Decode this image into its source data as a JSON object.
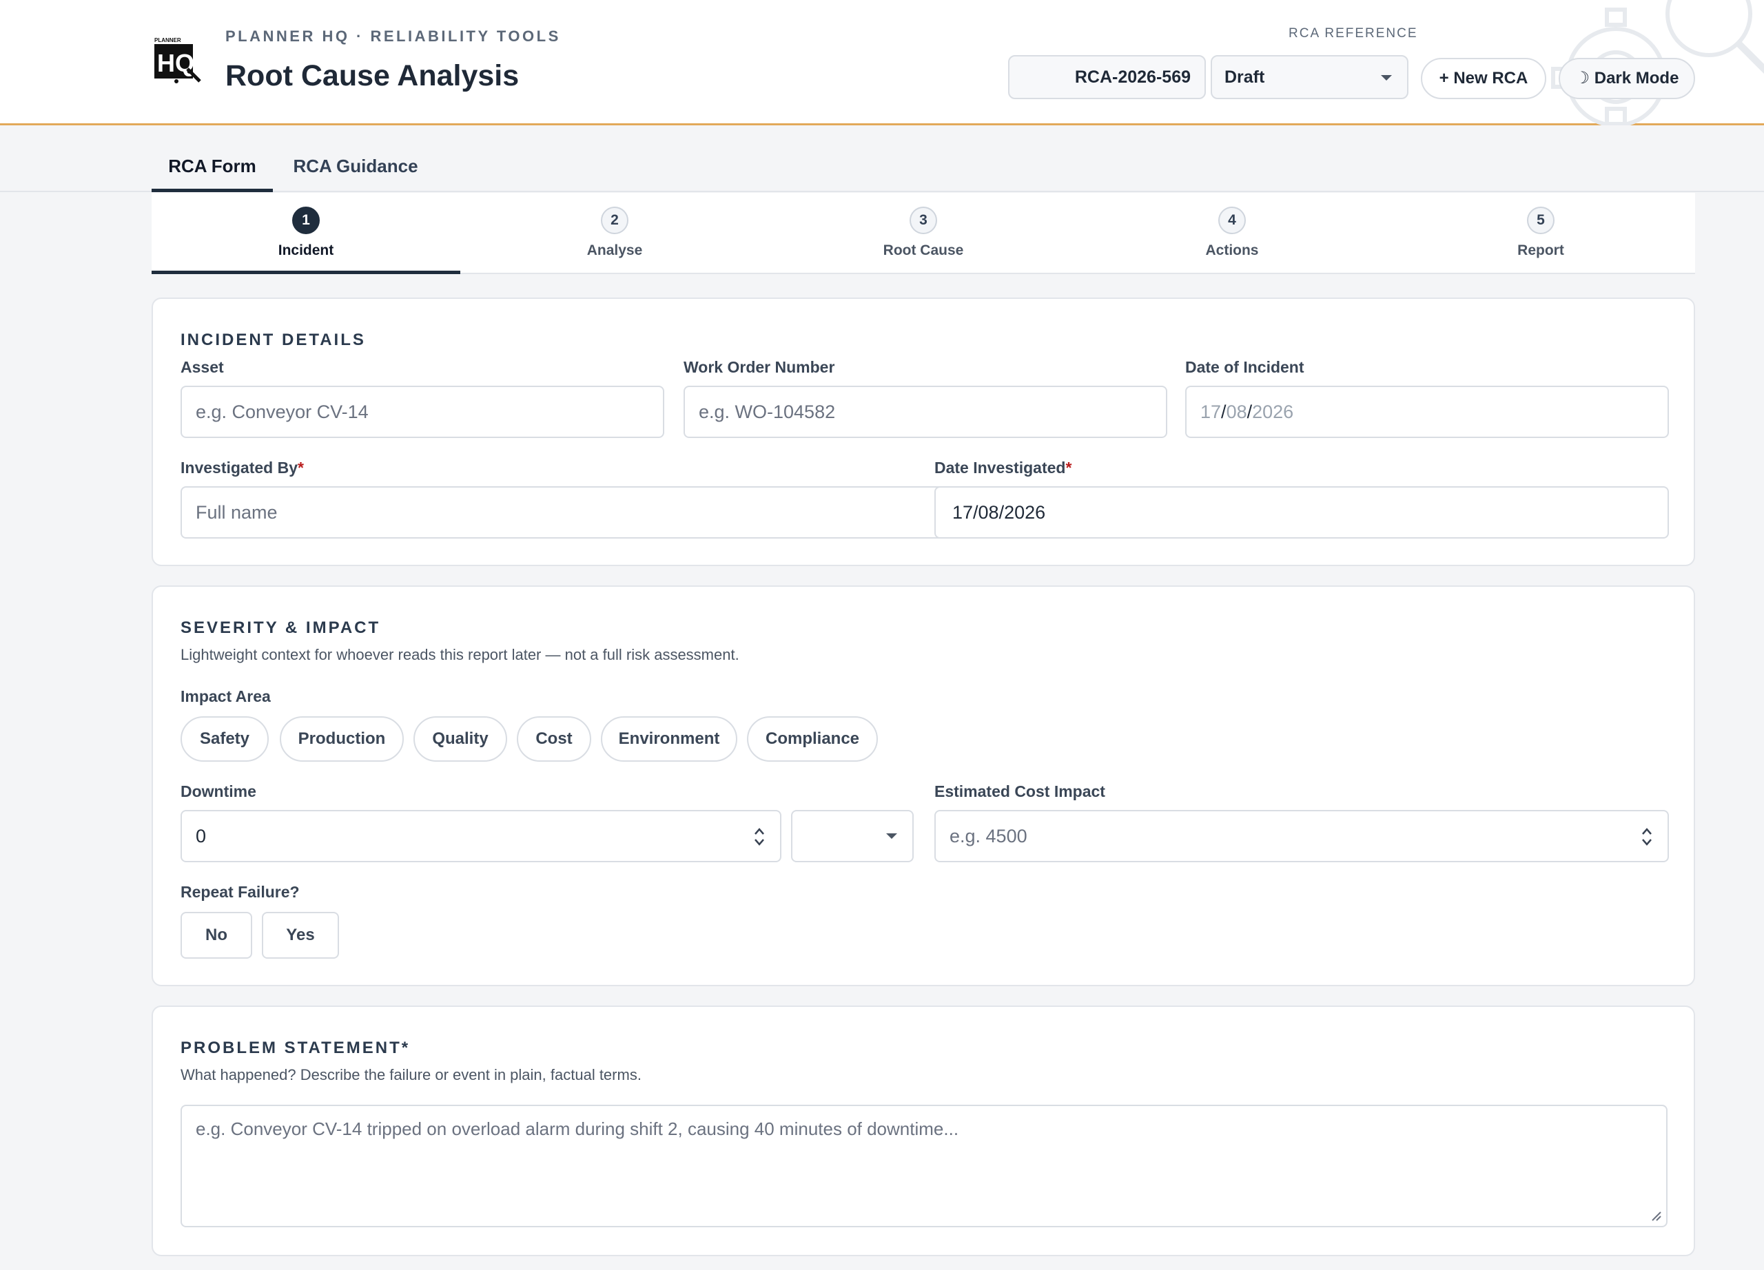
{
  "header": {
    "brand_sub": "PLANNER HQ · RELIABILITY TOOLS",
    "title": "Root Cause Analysis",
    "logo_text": "PLANNER HQ",
    "ref_label": "RCA REFERENCE",
    "ref_value": "RCA-2026-569",
    "status_value": "Draft",
    "new_rca_label": "+ New RCA",
    "dark_mode_label": "☽ Dark Mode"
  },
  "tabs": [
    {
      "label": "RCA Form"
    },
    {
      "label": "RCA Guidance"
    }
  ],
  "steps": [
    {
      "num": "1",
      "label": "Incident"
    },
    {
      "num": "2",
      "label": "Analyse"
    },
    {
      "num": "3",
      "label": "Root Cause"
    },
    {
      "num": "4",
      "label": "Actions"
    },
    {
      "num": "5",
      "label": "Report"
    }
  ],
  "incident": {
    "title": "INCIDENT DETAILS",
    "asset_label": "Asset",
    "asset_placeholder": "e.g. Conveyor CV-14",
    "wo_label": "Work Order Number",
    "wo_placeholder": "e.g. WO-104582",
    "date_label": "Date of Incident",
    "date_day": "17",
    "date_month": "08",
    "date_year": "2026",
    "investigated_by_label": "Investigated By",
    "investigated_by_placeholder": "Full name",
    "date_investigated_label": "Date Investigated",
    "date_investigated_value": "17/08/2026",
    "required_mark": "*"
  },
  "severity": {
    "title": "SEVERITY & IMPACT",
    "description": "Lightweight context for whoever reads this report later — not a full risk assessment.",
    "impact_label": "Impact Area",
    "impact_areas": [
      "Safety",
      "Production",
      "Quality",
      "Cost",
      "Environment",
      "Compliance"
    ],
    "downtime_label": "Downtime",
    "downtime_value": "0",
    "cost_label": "Estimated Cost Impact",
    "cost_placeholder": "e.g. 4500",
    "repeat_label": "Repeat Failure?",
    "repeat_no": "No",
    "repeat_yes": "Yes"
  },
  "problem": {
    "title": "PROBLEM STATEMENT*",
    "description": "What happened? Describe the failure or event in plain, factual terms.",
    "placeholder": "e.g. Conveyor CV-14 tripped on overload alarm during shift 2, causing 40 minutes of downtime..."
  },
  "colors": {
    "accent_border": "#e2a95a",
    "active_navy": "#1f2d3d",
    "required": "#b91c1c"
  }
}
